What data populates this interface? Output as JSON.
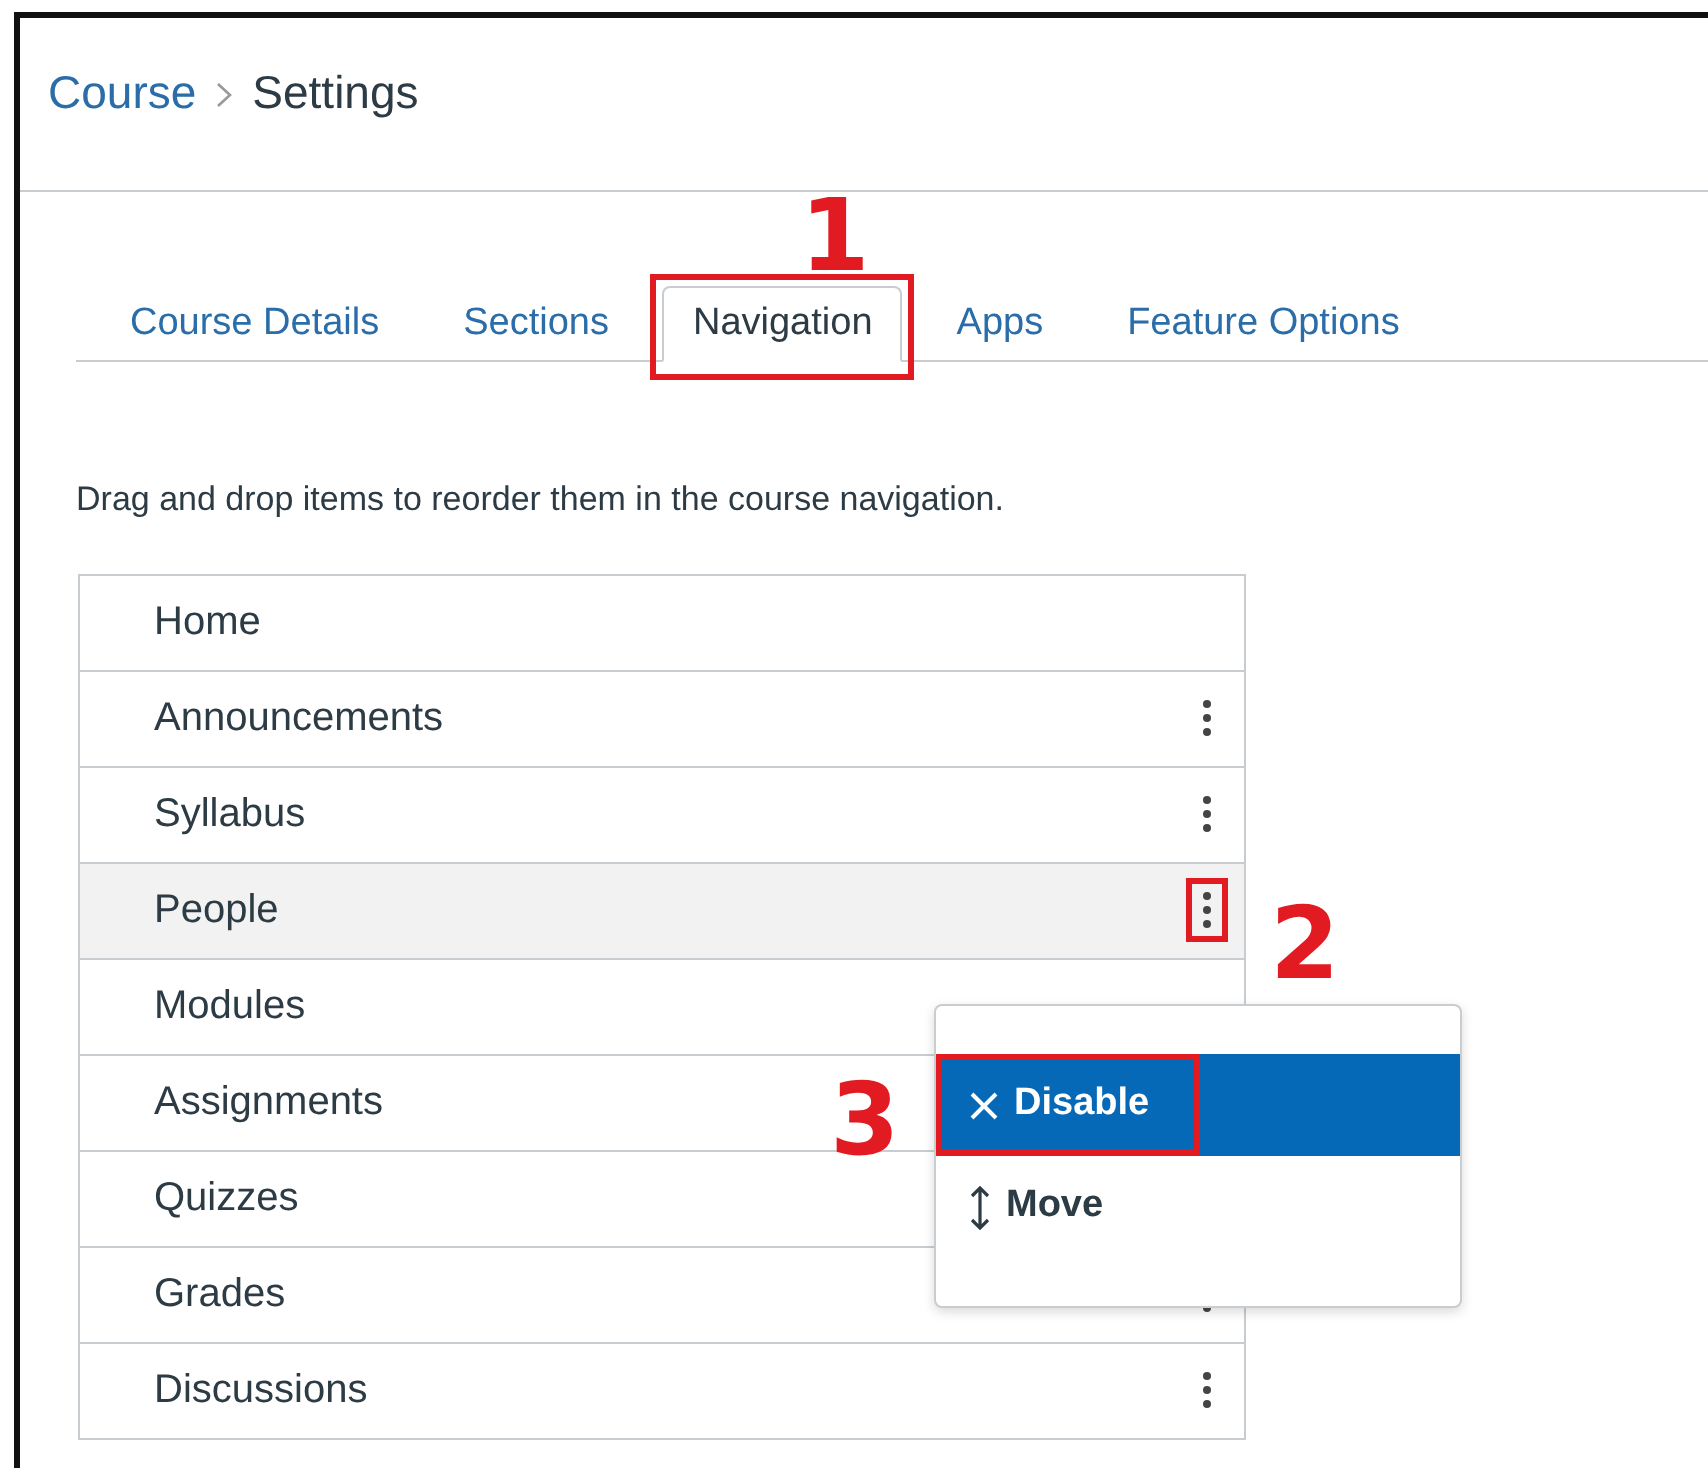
{
  "breadcrumb": [
    {
      "label": "Course",
      "link": true
    },
    {
      "label": "Settings",
      "link": false
    }
  ],
  "tabs": [
    {
      "label": "Course Details",
      "selected": false,
      "highlighted": false
    },
    {
      "label": "Sections",
      "selected": false,
      "highlighted": false
    },
    {
      "label": "Navigation",
      "selected": true,
      "highlighted": true
    },
    {
      "label": "Apps",
      "selected": false,
      "highlighted": false
    },
    {
      "label": "Feature Options",
      "selected": false,
      "highlighted": false
    }
  ],
  "instructions": "Drag and drop items to reorder them in the course navigation.",
  "nav_items": [
    {
      "label": "Home",
      "selected": false,
      "kebab": false
    },
    {
      "label": "Announcements",
      "selected": false,
      "kebab": true,
      "highlighted": false
    },
    {
      "label": "Syllabus",
      "selected": false,
      "kebab": true,
      "highlighted": false
    },
    {
      "label": "People",
      "selected": true,
      "kebab": true,
      "highlighted": true
    },
    {
      "label": "Modules",
      "selected": false,
      "kebab": false
    },
    {
      "label": "Assignments",
      "selected": false,
      "kebab": false
    },
    {
      "label": "Quizzes",
      "selected": false,
      "kebab": false
    },
    {
      "label": "Grades",
      "selected": false,
      "kebab": true,
      "highlighted": false
    },
    {
      "label": "Discussions",
      "selected": false,
      "kebab": true,
      "highlighted": false
    }
  ],
  "menu": [
    {
      "kind": "disable",
      "label": "Disable",
      "selected": true,
      "highlighted": true
    },
    {
      "kind": "move",
      "label": "Move",
      "selected": false,
      "highlighted": false
    }
  ],
  "step_numbers": [
    "1",
    "2",
    "3"
  ]
}
